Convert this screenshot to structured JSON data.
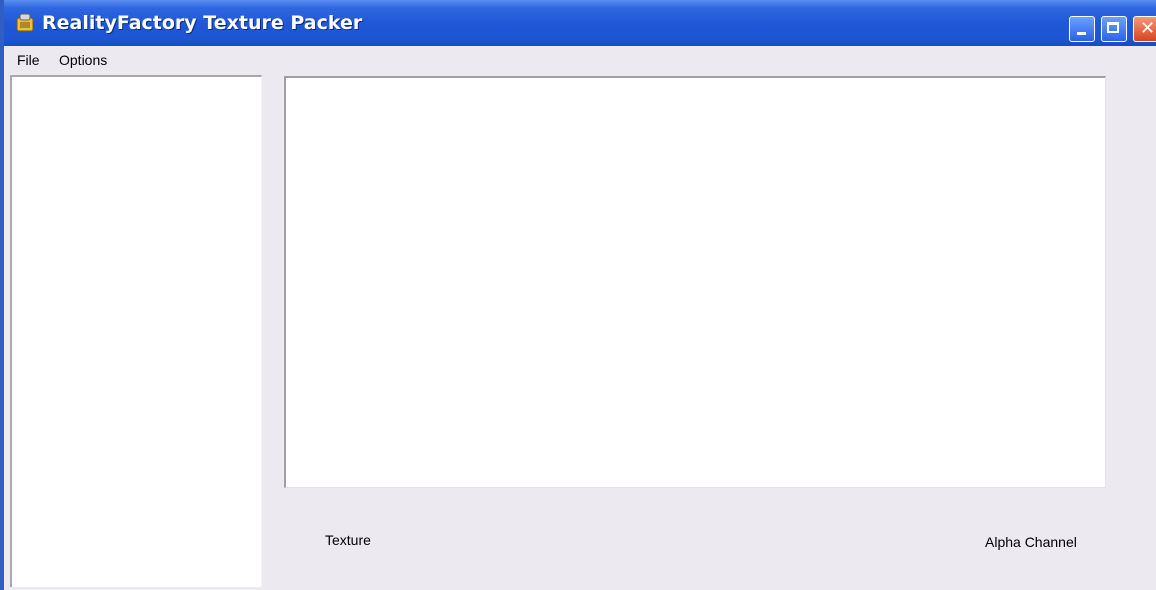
{
  "window": {
    "title": "RealityFactory Texture Packer",
    "icons": {
      "app": "app-icon",
      "minimize": "minimize-icon",
      "maximize": "maximize-icon",
      "close": "close-icon"
    },
    "colors": {
      "titlebar": "#1f58d8",
      "close_button": "#d8441c",
      "body": "#ece9f0"
    }
  },
  "menubar": {
    "items": [
      {
        "label": "File"
      },
      {
        "label": "Options"
      }
    ]
  },
  "main": {
    "texture_label": "Texture",
    "alpha_label": "Alpha Channel"
  }
}
